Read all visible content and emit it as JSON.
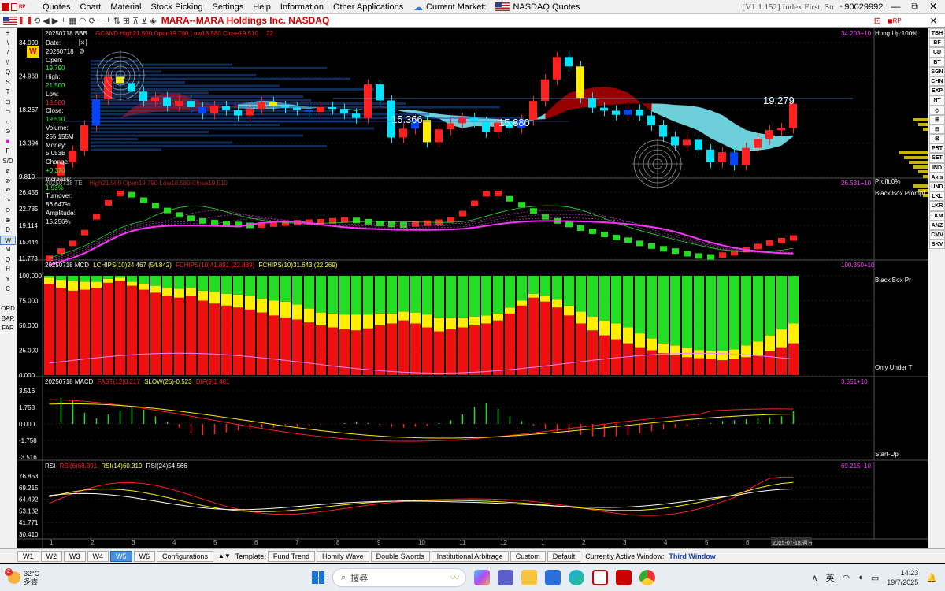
{
  "menubar": {
    "items": [
      "Quotes",
      "Chart",
      "Material",
      "Stock Picking",
      "Settings",
      "Help",
      "Information",
      "Other Applications"
    ],
    "current_market_label": "Current Market:",
    "market_name": "NASDAQ Quotes",
    "version": "[V1.1.152] Index First, Str",
    "account": "90029992"
  },
  "titlebar": {
    "title": "MARA--MARA Holdings Inc.  NASDAQ"
  },
  "left_toolbar": [
    "+",
    "\\",
    "/",
    "\\\\",
    "Q",
    "S",
    "T",
    "⊡",
    "▭",
    "○",
    "⊙",
    "■",
    "F",
    "S/D",
    "⌀",
    "⊘",
    "↶",
    "↷",
    "⊖",
    "⊕",
    "D",
    "W",
    "M",
    "Q",
    "H",
    "Y",
    "C",
    "",
    "ORD",
    "BAR",
    "FAR"
  ],
  "right_toolbar": [
    "TBH",
    "BF",
    "CD",
    "BT",
    "SGN",
    "CHN",
    "EXP",
    "NT",
    "◇",
    "⊞",
    "⊟",
    "⊠",
    "PRT",
    "SET",
    "IND",
    "Axis",
    "",
    "UND",
    "LKL",
    "LKR",
    "LKM",
    "ANZ",
    "",
    "CMV",
    "BKV"
  ],
  "panels": {
    "p1": {
      "date": "20250718",
      "name": "BBB",
      "detail": "GCAND High21.500 Open19.790 Low18.580 Close19.510",
      "mid": "22",
      "right": "34.203+10",
      "right_note": "Hung Up:100%",
      "ticks": [
        "34.090",
        "24.968",
        "18.267",
        "13.394",
        "9.810"
      ],
      "labels": {
        "a": "15.366",
        "b": "15.880",
        "c": "19.279"
      },
      "period_badge": "W"
    },
    "p2": {
      "date": "20250718",
      "name": "TE",
      "detail": "High21.500 Open19.790 Low18.580 Close19.510",
      "right": "26.531+10",
      "right_note": "Profit:0%",
      "right_note2": "Black Box Prompt",
      "ticks": [
        "26.455",
        "22.785",
        "19.114",
        "15.444",
        "11.773"
      ]
    },
    "p3": {
      "date": "20250718",
      "name": "MCD",
      "lc": "LCHIPS(10)24.467 (54.842)",
      "mc": "FCHIPS(10)41.891 (22.889)",
      "fc": "FCHIPS(10)31.643 (22.269)",
      "right": "100.350+10",
      "right_note": "Black Box Pr",
      "right_note2": "Only Under T",
      "ticks": [
        "100.000",
        "75.000",
        "50.000",
        "25.000",
        "0.000"
      ]
    },
    "p4": {
      "date": "20250718",
      "name": "MACD",
      "fast": "FAST(12)0.217",
      "slow": "SLOW(26)-0.523",
      "dif": "DIF(9)1.481",
      "right": "3.551+10",
      "right_note": "Start-Up",
      "ticks": [
        "3.516",
        "1.758",
        "0.000",
        "-1.758",
        "-3.516"
      ]
    },
    "p5": {
      "name": "RSI",
      "rsi6": "RSI(6)68.391",
      "rsi14": "RSI(14)60.319",
      "rsi24": "RSI(24)54.566",
      "right": "69.215+10",
      "ticks": [
        "76.853",
        "69.215",
        "64.492",
        "53.132",
        "41.771",
        "30.410"
      ]
    }
  },
  "data_window": {
    "date_label": "Date:",
    "date": "20250718",
    "open_label": "Open:",
    "open": "19.790",
    "high_label": "High:",
    "high": "21.500",
    "low_label": "Low:",
    "low": "18.580",
    "close_label": "Close:",
    "close": "19.510",
    "volume_label": "Volume:",
    "volume": "255.155M",
    "money_label": "Money:",
    "money": "5.053B",
    "change_label": "Change:",
    "change": "+0.370",
    "increase_label": "Increase:",
    "increase": "1.93%",
    "turnover_label": "Turnover:",
    "turnover": "86.647%",
    "amplitude_label": "Amplitude:",
    "amplitude": "15.256%"
  },
  "x_axis": {
    "labels": [
      "1",
      "2",
      "3",
      "4",
      "5",
      "6",
      "7",
      "8",
      "9",
      "10",
      "11",
      "12",
      "1",
      "2",
      "3",
      "4",
      "5",
      "6",
      "7"
    ],
    "current_date": "2025-07-18,週五"
  },
  "bottombar": {
    "tabs": [
      "W1",
      "W2",
      "W3",
      "W4",
      "W5",
      "W6"
    ],
    "active_tab": "W5",
    "config": "Configurations",
    "template_label": "Template:",
    "templates": [
      "Fund Trend",
      "Homily Wave",
      "Double Swords",
      "Institutional Arbitrage",
      "Custom",
      "Default"
    ],
    "active_window_label": "Currently Active Window:",
    "active_window": "Third Window"
  },
  "taskbar": {
    "temp": "32°C",
    "weather": "多雲",
    "badge": "2",
    "search_placeholder": "搜尋",
    "ime": "英",
    "time": "14:23",
    "date": "19/7/2025"
  },
  "colors": {
    "up": "#ff2020",
    "down": "#00e5ff",
    "cloud": "#7ef4ff",
    "bear_cloud": "#b00000",
    "green_bar": "#22dd22",
    "yellow_bar": "#ffee00",
    "red_bar": "#ee1010",
    "accent_title": "#d00000"
  }
}
